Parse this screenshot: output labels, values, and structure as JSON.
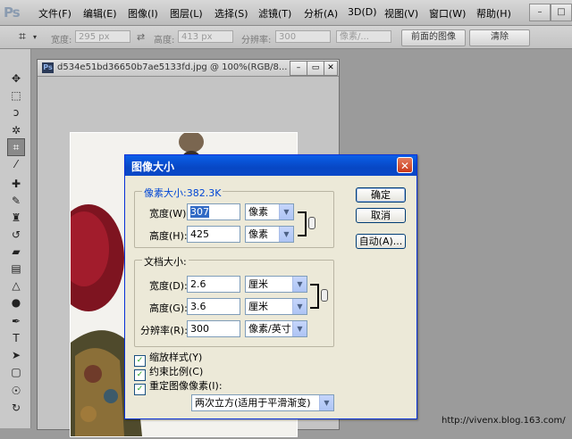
{
  "app": {
    "logo": "Ps"
  },
  "menu": [
    "文件(F)",
    "编辑(E)",
    "图像(I)",
    "图层(L)",
    "选择(S)",
    "滤镜(T)",
    "分析(A)",
    "3D(D)",
    "视图(V)",
    "窗口(W)",
    "帮助(H)"
  ],
  "window_controls": {
    "minimize": "–",
    "maximize": "□"
  },
  "options_bar": {
    "width_label": "宽度:",
    "width_value": "295 px",
    "height_label": "高度:",
    "height_value": "413 px",
    "resolution_label": "分辨率:",
    "resolution_value": "300",
    "unit_value": "像素/...",
    "front_image_button": "前面的图像",
    "clear_button": "清除"
  },
  "document": {
    "title": "d534e51bd36650b7ae5133fd.jpg @ 100%(RGB/8...",
    "ps_icon": "Ps"
  },
  "dialog": {
    "title": "图像大小",
    "close": "✕",
    "pixel_dimensions_label": "像素大小:382.3K",
    "pixel_width_label": "宽度(W):",
    "pixel_width_value": "307",
    "pixel_width_unit": "像素",
    "pixel_height_label": "高度(H):",
    "pixel_height_value": "425",
    "pixel_height_unit": "像素",
    "doc_size_label": "文档大小:",
    "doc_width_label": "宽度(D):",
    "doc_width_value": "2.6",
    "doc_width_unit": "厘米",
    "doc_height_label": "高度(G):",
    "doc_height_value": "3.6",
    "doc_height_unit": "厘米",
    "resolution_label": "分辨率(R):",
    "resolution_value": "300",
    "resolution_unit": "像素/英寸",
    "ok_button": "确定",
    "cancel_button": "取消",
    "auto_button": "自动(A)...",
    "scale_styles_label": "缩放样式(Y)",
    "constrain_label": "约束比例(C)",
    "resample_label": "重定图像像素(I):",
    "resample_method": "两次立方(适用于平滑渐变)"
  },
  "watermark_url": "http://vivenx.blog.163.com/",
  "colors": {
    "dialog_title": "#0747c4",
    "dialog_bg": "#ece9d8",
    "workspace": "#9b9b9b"
  }
}
